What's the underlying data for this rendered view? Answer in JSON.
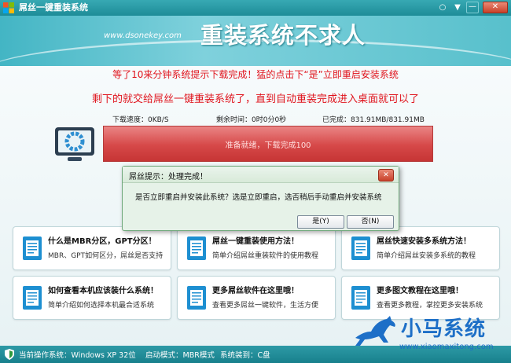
{
  "window": {
    "title": "屌丝一键重装系统",
    "controls": [
      "feedback-icon",
      "menu-icon",
      "minimize-icon",
      "close-icon"
    ]
  },
  "banner": {
    "url": "www.dsonekey.com",
    "slogan": "重装系统不求人"
  },
  "notice": {
    "line1": "等了10来分钟系统提示下载完成！猛的点击下“是”立即重启安装系统",
    "line2": "剩下的就交给屌丝一键重装系统了，直到自动重装完成进入桌面就可以了"
  },
  "progress": {
    "speed": "下载速度：0KB/S",
    "remaining": "剩余时间：0时0分0秒",
    "done": "已完成：831.91MB/831.91MB",
    "label": "准备就绪，下载完成100",
    "percent": 100
  },
  "dialog": {
    "title": "屌丝提示：处理完成！",
    "message": "是否立即重启并安装此系统？选是立即重启，选否稍后手动重启并安装系统",
    "yes_label": "是(Y)",
    "no_label": "否(N)"
  },
  "cards": [
    {
      "title": "什么是MBR分区，GPT分区！",
      "desc": "MBR、GPT如何区分，屌丝是否支持"
    },
    {
      "title": "屌丝一键重装使用方法！",
      "desc": "简单介绍屌丝重装软件的使用教程"
    },
    {
      "title": "屌丝快速安装多系统方法！",
      "desc": "简单介绍屌丝安装多系统的教程"
    },
    {
      "title": "如何查看本机应该装什么系统！",
      "desc": "简单介绍如何选择本机最合适系统"
    },
    {
      "title": "更多屌丝软件在这里哦！",
      "desc": "查看更多屌丝一键软件，生活方便"
    },
    {
      "title": "更多图文教程在这里哦！",
      "desc": "查看更多教程，掌控更多安装系统"
    }
  ],
  "status": {
    "os": "当前操作系统：Windows XP 32位",
    "boot": "启动模式：MBR模式",
    "target": "系统装到：C盘"
  },
  "watermark": {
    "name": "小马系统",
    "url": "www.xiaomaxitong.com"
  },
  "colors": {
    "accent": "#1e8c98",
    "notice_red": "#e0141d",
    "progress_red": "#d84949",
    "watermark_blue": "#1d6fc7"
  }
}
